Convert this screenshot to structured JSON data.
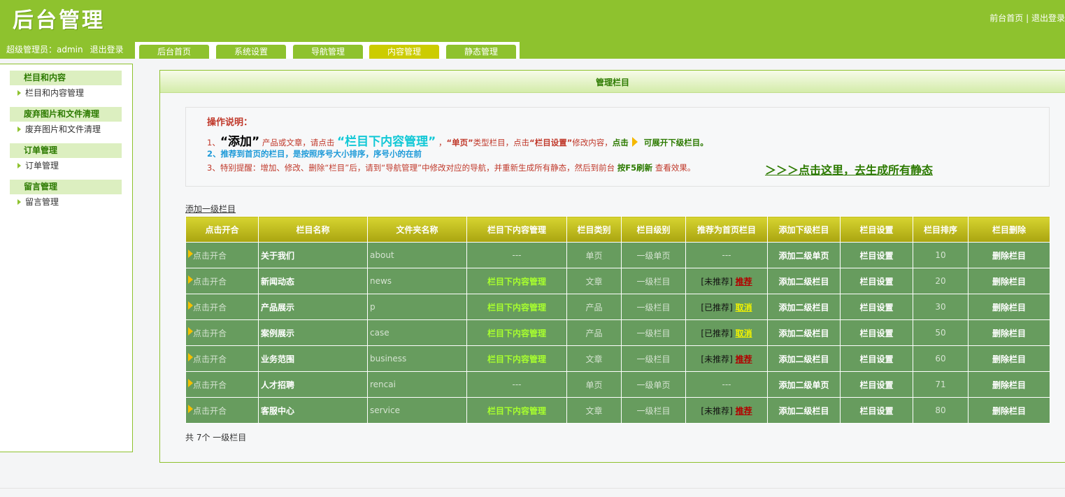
{
  "header": {
    "logo": "后台管理",
    "front_home": "前台首页",
    "separator": " | ",
    "logout_top": "退出登录",
    "admin_label": "超级管理员：admin",
    "logout": "退出登录"
  },
  "tabs": [
    {
      "label": "后台首页",
      "active": false
    },
    {
      "label": "系统设置",
      "active": false
    },
    {
      "label": "导航管理",
      "active": false
    },
    {
      "label": "内容管理",
      "active": true
    },
    {
      "label": "静态管理",
      "active": false
    }
  ],
  "sidebar": [
    {
      "title": "栏目和内容",
      "item": "栏目和内容管理"
    },
    {
      "title": "废弃图片和文件清理",
      "item": "废弃图片和文件清理"
    },
    {
      "title": "订单管理",
      "item": "订单管理"
    },
    {
      "title": "留言管理",
      "item": "留言管理"
    }
  ],
  "panel": {
    "title": "管理栏目",
    "notes_title": "操作说明：",
    "note1": {
      "p1": "1、",
      "p2": "“添加”",
      "p3": " 产品或文章，请点击 ",
      "p4": "“栏目下内容管理”",
      "p5": " ，",
      "p6": "“单页”",
      "p7": "类型栏目，点击",
      "p8": "“栏目设置”",
      "p9": "修改内容，",
      "p10": "点击",
      "p11": " 可展开下级栏目。"
    },
    "note2": "2、推荐到首页的栏目，是按照序号大小排序，序号小的在前",
    "note3": {
      "p1": "3、特别提醒：增加、修改、删除“栏目”后，请到“导航管理”中修改对应的导航，并重新生成所有静态，然后到前台 ",
      "p2": "按F5刷新",
      "p3": " 查看效果。"
    },
    "gen_link": "＞＞＞点击这里，去生成所有静态",
    "add_top": "添加一级栏目",
    "total": "共 7个 一级栏目"
  },
  "table": {
    "headers": [
      "点击开合",
      "栏目名称",
      "文件夹名称",
      "栏目下内容管理",
      "栏目类别",
      "栏目级别",
      "推荐为首页栏目",
      "添加下级栏目",
      "栏目设置",
      "栏目排序",
      "栏目删除"
    ],
    "rows": [
      {
        "toggle": "点击开合",
        "name": "关于我们",
        "folder": "about",
        "content": "---",
        "type": "单页",
        "level": "一级单页",
        "rec_status": "---",
        "rec_action": "",
        "add_sub": "添加二级单页",
        "setting": "栏目设置",
        "order": "10",
        "delete": "删除栏目"
      },
      {
        "toggle": "点击开合",
        "name": "新闻动态",
        "folder": "news",
        "content": "栏目下内容管理",
        "type": "文章",
        "level": "一级栏目",
        "rec_status": "[未推荐]",
        "rec_action": "推荐",
        "add_sub": "添加二级栏目",
        "setting": "栏目设置",
        "order": "20",
        "delete": "删除栏目"
      },
      {
        "toggle": "点击开合",
        "name": "产品展示",
        "folder": "p",
        "content": "栏目下内容管理",
        "type": "产品",
        "level": "一级栏目",
        "rec_status": "[已推荐]",
        "rec_action": "取消",
        "add_sub": "添加二级栏目",
        "setting": "栏目设置",
        "order": "30",
        "delete": "删除栏目"
      },
      {
        "toggle": "点击开合",
        "name": "案例展示",
        "folder": "case",
        "content": "栏目下内容管理",
        "type": "产品",
        "level": "一级栏目",
        "rec_status": "[已推荐]",
        "rec_action": "取消",
        "add_sub": "添加二级栏目",
        "setting": "栏目设置",
        "order": "50",
        "delete": "删除栏目"
      },
      {
        "toggle": "点击开合",
        "name": "业务范围",
        "folder": "business",
        "content": "栏目下内容管理",
        "type": "文章",
        "level": "一级栏目",
        "rec_status": "[未推荐]",
        "rec_action": "推荐",
        "add_sub": "添加二级栏目",
        "setting": "栏目设置",
        "order": "60",
        "delete": "删除栏目"
      },
      {
        "toggle": "点击开合",
        "name": "人才招聘",
        "folder": "rencai",
        "content": "---",
        "type": "单页",
        "level": "一级单页",
        "rec_status": "---",
        "rec_action": "",
        "add_sub": "添加二级单页",
        "setting": "栏目设置",
        "order": "71",
        "delete": "删除栏目"
      },
      {
        "toggle": "点击开合",
        "name": "客服中心",
        "folder": "service",
        "content": "栏目下内容管理",
        "type": "文章",
        "level": "一级栏目",
        "rec_status": "[未推荐]",
        "rec_action": "推荐",
        "add_sub": "添加二级栏目",
        "setting": "栏目设置",
        "order": "80",
        "delete": "删除栏目"
      }
    ]
  },
  "colors": {
    "brand_green": "#8ec22e",
    "active_tab": "#cccc00",
    "row_green": "#679c5e",
    "header_gold": "#c4c01e"
  }
}
